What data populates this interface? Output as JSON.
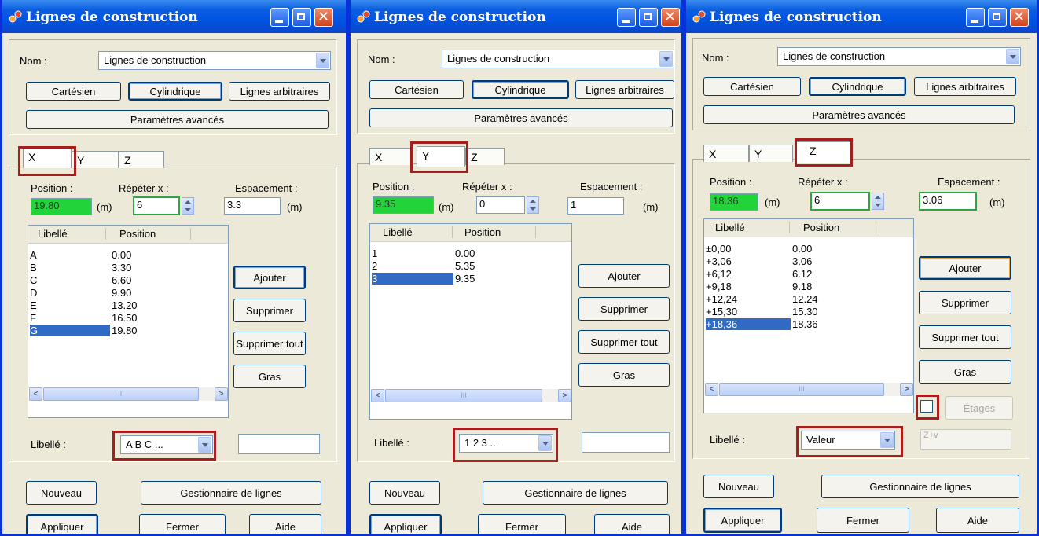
{
  "dialogs": [
    {
      "title": "Lignes de construction",
      "nom_label": "Nom :",
      "nom_value": "Lignes de construction",
      "mode_buttons": [
        "Cartésien",
        "Cylindrique",
        "Lignes arbitraires"
      ],
      "advanced_label": "Paramètres avancés",
      "tabs": [
        "X",
        "Y",
        "Z"
      ],
      "active_tab": "X",
      "position_label": "Position :",
      "position_value": "19.80",
      "position_unit": "(m)",
      "repeat_label": "Répéter x :",
      "repeat_value": "6",
      "spacing_label": "Espacement :",
      "spacing_value": "3.3",
      "spacing_unit": "(m)",
      "list_headers": [
        "Libellé",
        "Position"
      ],
      "rows": [
        {
          "label": "A",
          "pos": "0.00"
        },
        {
          "label": "B",
          "pos": "3.30"
        },
        {
          "label": "C",
          "pos": "6.60"
        },
        {
          "label": "D",
          "pos": "9.90"
        },
        {
          "label": "E",
          "pos": "13.20"
        },
        {
          "label": "F",
          "pos": "16.50"
        },
        {
          "label": "G",
          "pos": "19.80",
          "selected": true
        }
      ],
      "side_buttons": [
        "Ajouter",
        "Supprimer",
        "Supprimer tout",
        "Gras"
      ],
      "libelle_label": "Libellé :",
      "libelle_value": "A B C ...",
      "extra_field": "",
      "bottom_buttons_row1": [
        "Nouveau",
        "Gestionnaire de lignes"
      ],
      "bottom_buttons_row2": [
        "Appliquer",
        "Fermer",
        "Aide"
      ]
    },
    {
      "title": "Lignes de construction",
      "nom_label": "Nom :",
      "nom_value": "Lignes de construction",
      "mode_buttons": [
        "Cartésien",
        "Cylindrique",
        "Lignes arbitraires"
      ],
      "advanced_label": "Paramètres avancés",
      "tabs": [
        "X",
        "Y",
        "Z"
      ],
      "active_tab": "Y",
      "position_label": "Position :",
      "position_value": "9.35",
      "position_unit": "(m)",
      "repeat_label": "Répéter x :",
      "repeat_value": "0",
      "spacing_label": "Espacement :",
      "spacing_value": "1",
      "spacing_unit": "(m)",
      "list_headers": [
        "Libellé",
        "Position"
      ],
      "rows": [
        {
          "label": "1",
          "pos": "0.00"
        },
        {
          "label": "2",
          "pos": "5.35"
        },
        {
          "label": "3",
          "pos": "9.35",
          "selected": true
        }
      ],
      "side_buttons": [
        "Ajouter",
        "Supprimer",
        "Supprimer tout",
        "Gras"
      ],
      "libelle_label": "Libellé :",
      "libelle_value": "1 2 3 ...",
      "extra_field": "",
      "bottom_buttons_row1": [
        "Nouveau",
        "Gestionnaire de lignes"
      ],
      "bottom_buttons_row2": [
        "Appliquer",
        "Fermer",
        "Aide"
      ]
    },
    {
      "title": "Lignes de construction",
      "nom_label": "Nom :",
      "nom_value": "Lignes de construction",
      "mode_buttons": [
        "Cartésien",
        "Cylindrique",
        "Lignes arbitraires"
      ],
      "advanced_label": "Paramètres avancés",
      "tabs": [
        "X",
        "Y",
        "Z"
      ],
      "active_tab": "Z",
      "position_label": "Position :",
      "position_value": "18.36",
      "position_unit": "(m)",
      "repeat_label": "Répéter x :",
      "repeat_value": "6",
      "spacing_label": "Espacement :",
      "spacing_value": "3.06",
      "spacing_unit": "(m)",
      "list_headers": [
        "Libellé",
        "Position"
      ],
      "rows": [
        {
          "label": "±0,00",
          "pos": "0.00"
        },
        {
          "label": "+3,06",
          "pos": "3.06"
        },
        {
          "label": "+6,12",
          "pos": "6.12"
        },
        {
          "label": "+9,18",
          "pos": "9.18"
        },
        {
          "label": "+12,24",
          "pos": "12.24"
        },
        {
          "label": "+15,30",
          "pos": "15.30"
        },
        {
          "label": "+18,36",
          "pos": "18.36",
          "selected": true
        }
      ],
      "side_buttons": [
        "Ajouter",
        "Supprimer",
        "Supprimer tout",
        "Gras"
      ],
      "etages_label": "Étages",
      "libelle_label": "Libellé :",
      "libelle_value": "Valeur",
      "extra_field": "Z+v",
      "bottom_buttons_row1": [
        "Nouveau",
        "Gestionnaire de lignes"
      ],
      "bottom_buttons_row2": [
        "Appliquer",
        "Fermer",
        "Aide"
      ]
    }
  ]
}
